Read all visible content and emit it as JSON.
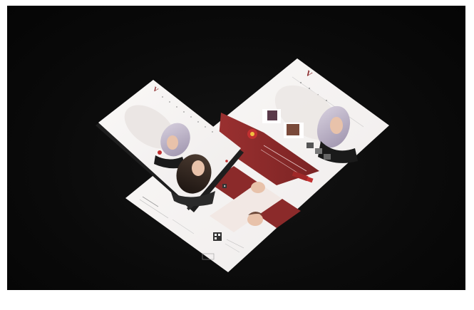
{
  "scene": {
    "kind": "website-mockup-presentation",
    "background_color": "#0a0a0a",
    "accent_color": "#8b2a2a"
  },
  "brand": {
    "logo_letter": "V",
    "logo_color": "#8b2a2a"
  },
  "front_screen": {
    "hero_section": "hero-image-woman-lilac-hair",
    "secondary_hero": "hero-image-woman-dark-hair"
  },
  "back_screen": {
    "hero_section": "hero-image-woman-lilac-hair",
    "accent_band_color": "#8b2a2a"
  },
  "colors": {
    "page": "#f4f2f1",
    "accent": "#8b2a2a",
    "accent_dark": "#6e1f1f",
    "device": "#1e1e1e",
    "hair_lilac": "#c9bfd2",
    "hair_dark": "#3a2a22",
    "skin": "#e8c2aa"
  }
}
